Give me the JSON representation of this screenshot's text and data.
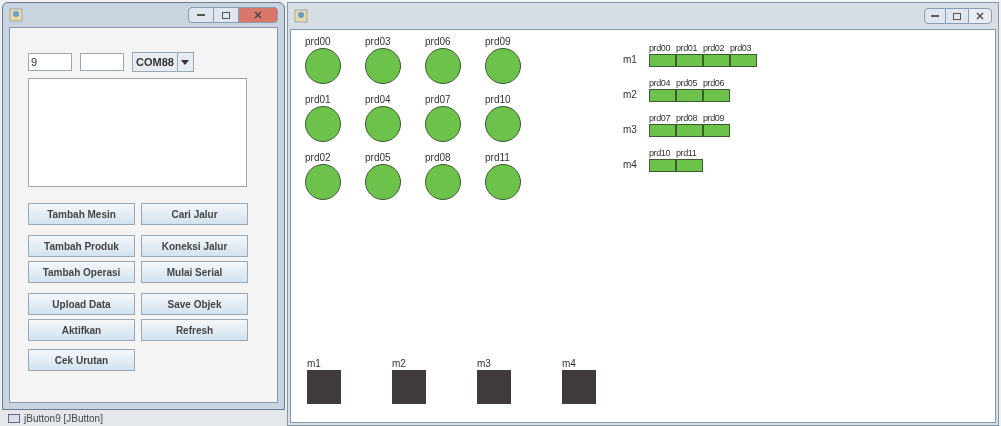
{
  "control_window": {
    "fields": [
      {
        "value": "9"
      }
    ],
    "port_select": {
      "value": "COM88"
    },
    "buttons": [
      {
        "label": "Tambah Mesin"
      },
      {
        "label": "Cari Jalur"
      },
      {
        "label": "Tambah Produk"
      },
      {
        "label": "Koneksi Jalur"
      },
      {
        "label": "Tambah Operasi"
      },
      {
        "label": "Mulai Serial"
      },
      {
        "label": "Upload Data"
      },
      {
        "label": "Save Objek"
      },
      {
        "label": "Aktifkan"
      },
      {
        "label": "Refresh"
      },
      {
        "label": "Cek Urutan"
      }
    ]
  },
  "status_bar": "jButton9 [JButton]",
  "canvas": {
    "products": [
      {
        "label": "prd00"
      },
      {
        "label": "prd03"
      },
      {
        "label": "prd06"
      },
      {
        "label": "prd09"
      },
      {
        "label": "prd01"
      },
      {
        "label": "prd04"
      },
      {
        "label": "prd07"
      },
      {
        "label": "prd10"
      },
      {
        "label": "prd02"
      },
      {
        "label": "prd05"
      },
      {
        "label": "prd08"
      },
      {
        "label": "prd11"
      }
    ],
    "schedule": [
      {
        "machine": "m1",
        "jobs": [
          "prd00",
          "prd01",
          "prd02",
          "prd03"
        ]
      },
      {
        "machine": "m2",
        "jobs": [
          "prd04",
          "prd05",
          "prd06"
        ]
      },
      {
        "machine": "m3",
        "jobs": [
          "prd07",
          "prd08",
          "prd09"
        ]
      },
      {
        "machine": "m4",
        "jobs": [
          "prd10",
          "prd11"
        ]
      }
    ],
    "machines": [
      {
        "label": "m1"
      },
      {
        "label": "m2"
      },
      {
        "label": "m3"
      },
      {
        "label": "m4"
      }
    ]
  }
}
